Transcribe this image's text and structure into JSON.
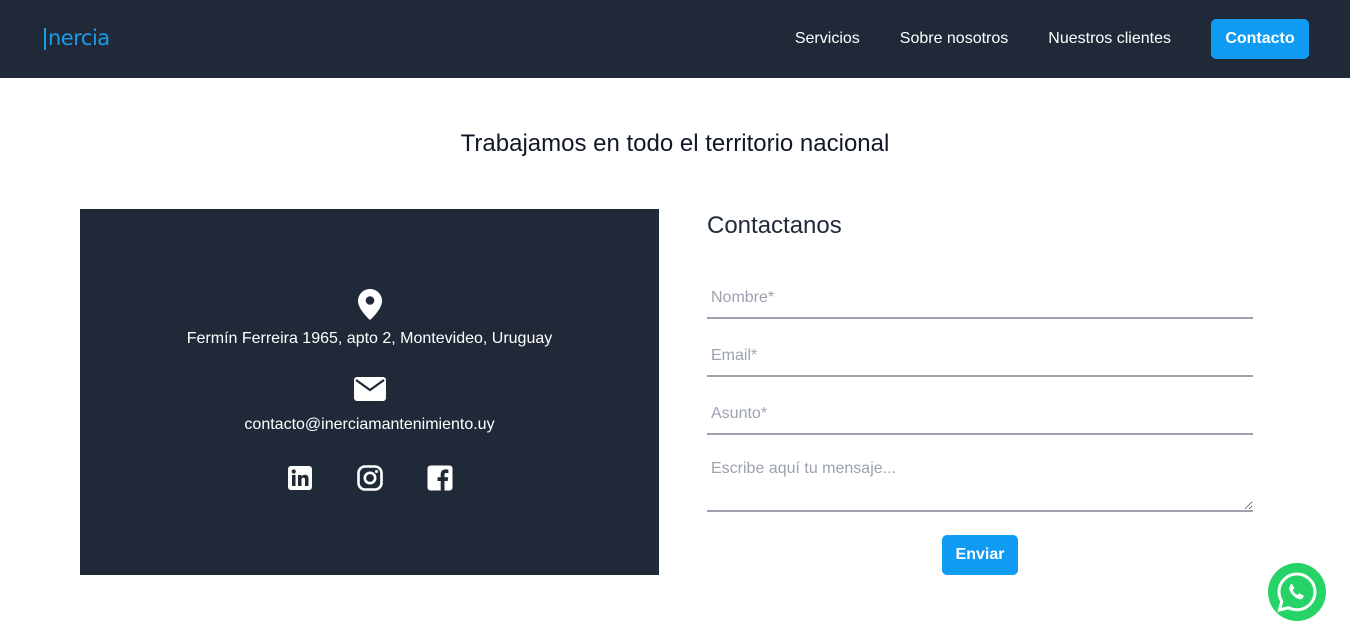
{
  "nav": {
    "logo": "nercia",
    "links": [
      "Servicios",
      "Sobre nosotros",
      "Nuestros clientes"
    ],
    "cta": "Contacto"
  },
  "section": {
    "title": "Trabajamos en todo el territorio nacional"
  },
  "info": {
    "address": "Fermín Ferreira 1965, apto 2, Montevideo, Uruguay",
    "email": "contacto@inerciamantenimiento.uy",
    "socials": [
      "linkedin-icon",
      "instagram-icon",
      "facebook-icon"
    ]
  },
  "form": {
    "title": "Contactanos",
    "name_placeholder": "Nombre*",
    "email_placeholder": "Email*",
    "subject_placeholder": "Asunto*",
    "message_placeholder": "Escribe aquí tu mensaje...",
    "submit": "Enviar"
  },
  "colors": {
    "dark": "#1f2937",
    "accent": "#0f9bf2",
    "whatsapp": "#25d366"
  }
}
